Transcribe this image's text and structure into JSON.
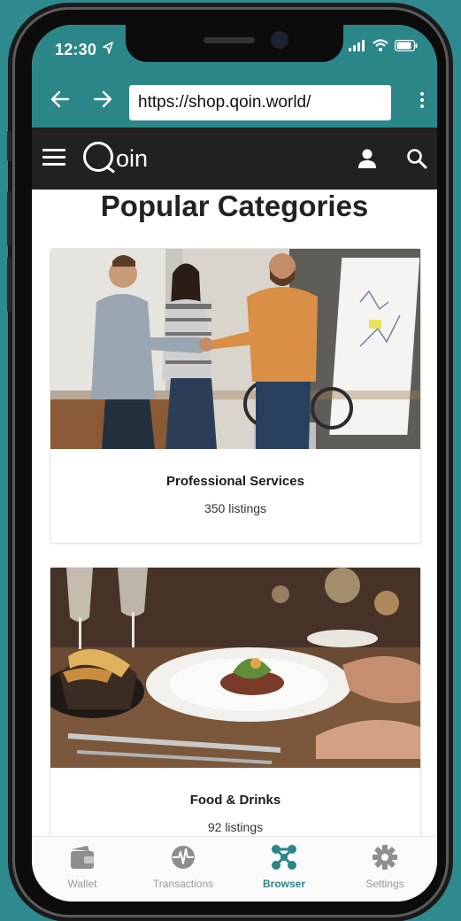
{
  "status_bar": {
    "time": "12:30"
  },
  "browser": {
    "url": "https://shop.qoin.world/",
    "back_icon": "back-arrow-icon",
    "forward_icon": "forward-arrow-icon",
    "menu_icon": "kebab-menu-icon"
  },
  "app_header": {
    "logo_text": "oin",
    "menu_icon": "hamburger-icon",
    "account_icon": "user-icon",
    "search_icon": "search-icon"
  },
  "page": {
    "title": "Popular Categories",
    "categories": [
      {
        "name": "Professional Services",
        "count": "350 listings",
        "image": "business-handshake-photo"
      },
      {
        "name": "Food & Drinks",
        "count": "92 listings",
        "image": "restaurant-dinner-photo"
      }
    ]
  },
  "tab_bar": {
    "active": "Browser",
    "accent": "#2b8688",
    "tabs": [
      {
        "label": "Wallet",
        "icon": "wallet-icon"
      },
      {
        "label": "Transactions",
        "icon": "pulse-icon"
      },
      {
        "label": "Browser",
        "icon": "network-icon"
      },
      {
        "label": "Settings",
        "icon": "gear-icon"
      }
    ]
  },
  "colors": {
    "brand_teal": "#2b8688",
    "header_dark": "#212121"
  }
}
